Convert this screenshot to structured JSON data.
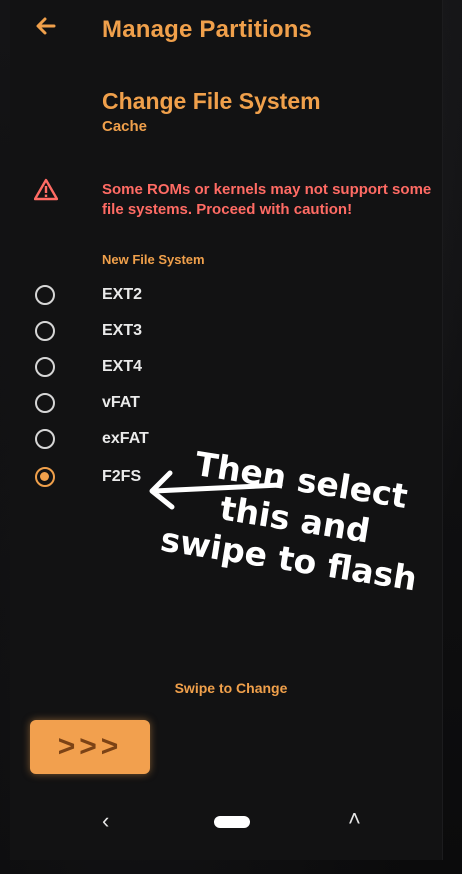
{
  "header": {
    "title": "Manage Partitions",
    "subtitle": "Change File System",
    "partition": "Cache"
  },
  "warning": {
    "text": "Some ROMs or kernels may not support some file systems. Proceed with caution!"
  },
  "filesystem": {
    "label": "New File System",
    "options": [
      "EXT2",
      "EXT3",
      "EXT4",
      "vFAT",
      "exFAT",
      "F2FS"
    ],
    "selected": "F2FS"
  },
  "annotation": {
    "text": "Then select this and swipe to flash"
  },
  "swipe": {
    "label": "Swipe to Change",
    "button_glyph": ">>>"
  },
  "nav": {
    "back_glyph": "‹",
    "recent_glyph": "˄"
  },
  "colors": {
    "accent": "#f0a04b",
    "warning": "#ff6b64",
    "background": "#121213"
  },
  "icons": [
    "back-arrow-icon",
    "warning-triangle-icon"
  ]
}
